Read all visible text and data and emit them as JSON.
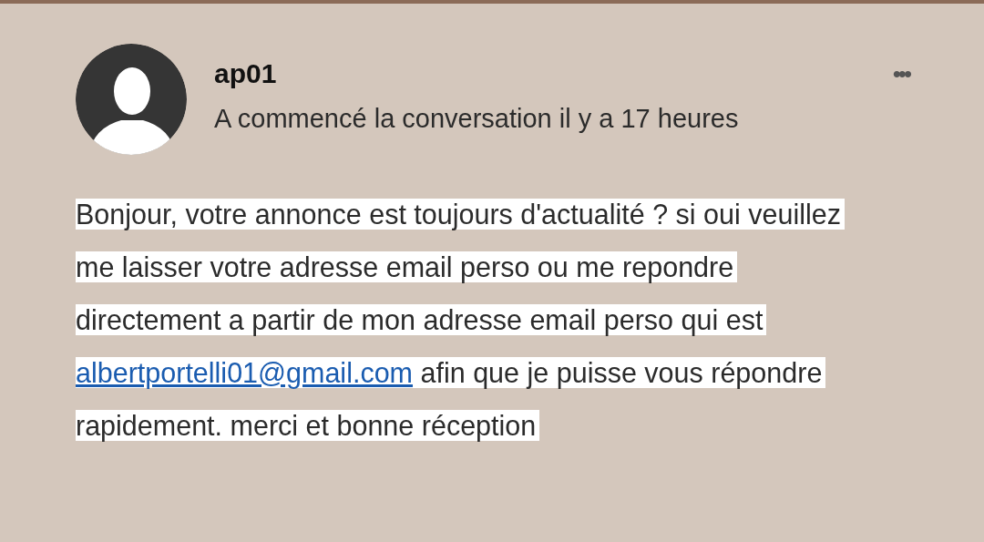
{
  "author": {
    "name": "ap01",
    "subtitle": "A commencé la conversation il y a 17 heures"
  },
  "menu": {
    "label": "•••"
  },
  "message": {
    "text_before": "Bonjour, votre annonce est toujours d'actualité ? si oui veuillez me laisser votre adresse email perso ou me repondre directement a partir de mon adresse email perso qui est ",
    "link": "albertportelli01@gmail.com",
    "text_after": " afin que je puisse vous répondre rapidement. merci et bonne réception"
  }
}
